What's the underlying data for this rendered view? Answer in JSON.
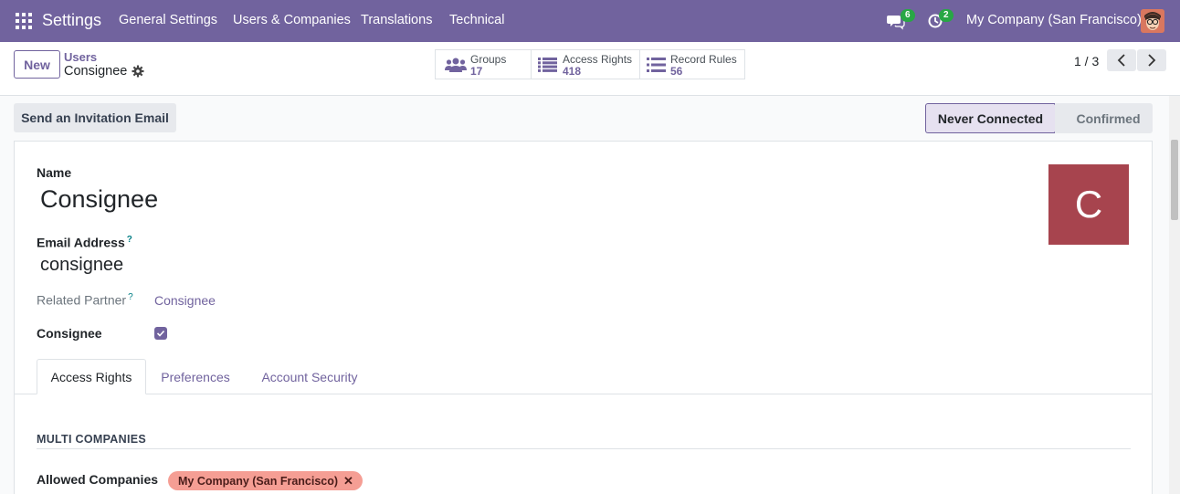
{
  "navbar": {
    "brand": "Settings",
    "menu": [
      "General Settings",
      "Users & Companies",
      "Translations",
      "Technical"
    ],
    "messages_badge": "6",
    "activities_badge": "2",
    "company": "My Company (San Francisco)"
  },
  "control": {
    "new_label": "New",
    "breadcrumb_parent": "Users",
    "breadcrumb_current": "Consignee",
    "smart_buttons": [
      {
        "label": "Groups",
        "value": "17",
        "icon": "users-icon"
      },
      {
        "label": "Access Rights",
        "value": "418",
        "icon": "list-icon"
      },
      {
        "label": "Record Rules",
        "value": "56",
        "icon": "list-icon"
      }
    ],
    "pager": "1 / 3"
  },
  "actions": {
    "invite_label": "Send an Invitation Email"
  },
  "status": {
    "current": "Never Connected",
    "next": "Confirmed"
  },
  "form": {
    "name_label": "Name",
    "name_value": "Consignee",
    "email_label": "Email Address",
    "email_help": "?",
    "email_value": "consignee",
    "partner_label": "Related Partner",
    "partner_help": "?",
    "partner_value": "Consignee",
    "consignee_label": "Consignee",
    "consignee_checked": true,
    "avatar_initial": "C",
    "avatar_color": "#a7444e"
  },
  "tabs": [
    {
      "label": "Access Rights",
      "active": true
    },
    {
      "label": "Preferences",
      "active": false
    },
    {
      "label": "Account Security",
      "active": false
    }
  ],
  "multi_companies": {
    "title": "MULTI COMPANIES",
    "allowed_label": "Allowed Companies",
    "tags": [
      "My Company (San Francisco)"
    ]
  },
  "colors": {
    "brand": "#71639e",
    "badge": "#28a745"
  }
}
